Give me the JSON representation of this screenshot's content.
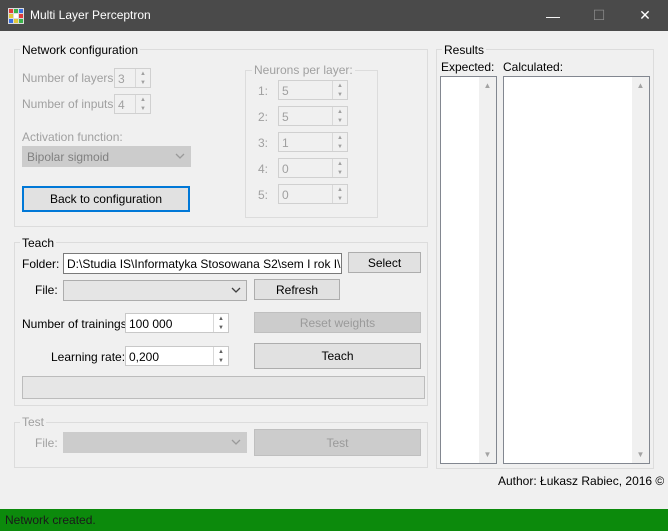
{
  "window": {
    "title": "Multi Layer Perceptron",
    "minimize_glyph": "—",
    "maximize_glyph": "☐",
    "close_glyph": "✕",
    "app_icon": "grid-app-icon"
  },
  "network_config": {
    "group_title": "Network configuration",
    "layers_label": "Number of layers:",
    "layers_value": "3",
    "inputs_label": "Number of inputs:",
    "inputs_value": "4",
    "activation_label": "Activation function:",
    "activation_value": "Bipolar sigmoid",
    "back_button": "Back to configuration",
    "neurons_group_title": "Neurons per layer:",
    "neurons": [
      {
        "label": "1:",
        "value": "5"
      },
      {
        "label": "2:",
        "value": "5"
      },
      {
        "label": "3:",
        "value": "1"
      },
      {
        "label": "4:",
        "value": "0"
      },
      {
        "label": "5:",
        "value": "0"
      }
    ]
  },
  "teach": {
    "group_title": "Teach",
    "folder_label": "Folder:",
    "folder_value": "D:\\Studia IS\\Informatyka Stosowana S2\\sem I rok I\\Sztuc",
    "select_button": "Select",
    "file_label": "File:",
    "file_value": "",
    "refresh_button": "Refresh",
    "trainings_label": "Number of trainings:",
    "trainings_value": "100 000",
    "reset_button": "Reset weights",
    "rate_label": "Learning rate:",
    "rate_value": "0,200",
    "teach_button": "Teach",
    "progress": 0
  },
  "test": {
    "group_title": "Test",
    "file_label": "File:",
    "file_value": "",
    "test_button": "Test"
  },
  "results": {
    "group_title": "Results",
    "expected_label": "Expected:",
    "calculated_label": "Calculated:"
  },
  "author": "Author: Łukasz Rabiec, 2016 ©",
  "status": {
    "text": "Network created.",
    "color": "#0c8a0c"
  }
}
